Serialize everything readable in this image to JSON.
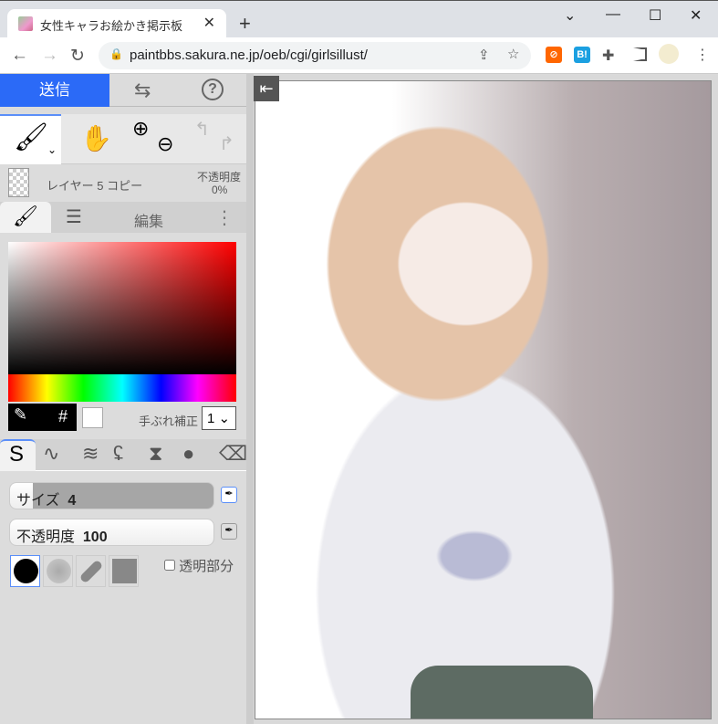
{
  "browser": {
    "tab_title": "女性キャラお絵かき掲示板",
    "url": "paintbbs.sakura.ne.jp/oeb/cgi/girlsillust/",
    "new_tab": "+",
    "close": "✕"
  },
  "panel": {
    "send": "送信",
    "swap": "⇆",
    "help": "?",
    "layer": {
      "name": "レイヤー 5 コピー",
      "opacity_label": "不透明度",
      "opacity_value": "0%"
    },
    "edit_tab": "編集",
    "color": {
      "current": "#000000",
      "secondary": "#ffffff",
      "hash": "#"
    },
    "steady": {
      "label": "手ぶれ補正",
      "value": "1"
    },
    "size": {
      "label": "サイズ",
      "value": "4",
      "fill_percent": 11
    },
    "opacity": {
      "label": "不透明度",
      "value": "100",
      "fill_percent": 100
    },
    "transparent_label": "透明部分"
  },
  "colors": {
    "accent": "#2b6af7"
  }
}
